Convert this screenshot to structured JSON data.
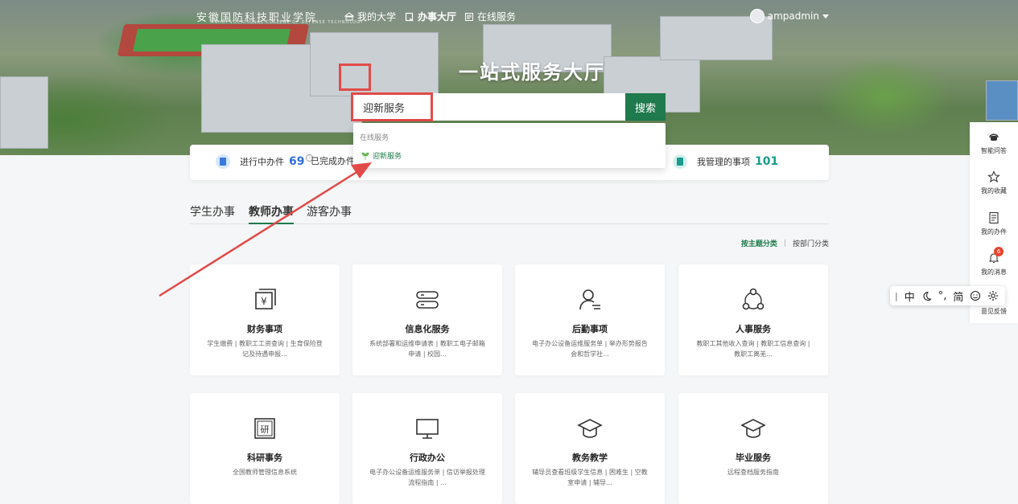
{
  "header": {
    "logo_text": "安徽国防科技职业学院",
    "logo_sub": "ANHUI VOCATIONAL COLLEGE OF DEFENSE TECHNOLOGY",
    "nav": [
      {
        "label": "我的大学",
        "icon": "university-icon"
      },
      {
        "label": "办事大厅",
        "icon": "service-hall-icon"
      },
      {
        "label": "在线服务",
        "icon": "online-service-icon"
      }
    ],
    "user": "ampadmin"
  },
  "hero": {
    "title": "一站式服务大厅"
  },
  "search": {
    "value": "迎新服务",
    "button": "搜索"
  },
  "dropdown": {
    "group": "在线服务",
    "item": "迎新服务"
  },
  "stats": {
    "in_progress_label": "进行中办件",
    "in_progress_value": "69",
    "completed_label": "已完成办件",
    "managed_label": "我管理的事项",
    "managed_value": "101"
  },
  "tabs": [
    "学生办事",
    "教师办事",
    "游客办事"
  ],
  "sort": {
    "by_theme": "按主题分类",
    "by_dept": "按部门分类"
  },
  "cards": [
    {
      "title": "财务事项",
      "desc": "学生缴费 | 教职工工资查询 | 生育保险登记及待遇申报...",
      "icon": "finance-icon"
    },
    {
      "title": "信息化服务",
      "desc": "系统部署和运维申请表 | 教职工电子邮箱申请 | 校园...",
      "icon": "server-icon"
    },
    {
      "title": "后勤事项",
      "desc": "电子办公设备运维服务单 | 举办形势报告会和哲学社...",
      "icon": "logistics-icon"
    },
    {
      "title": "人事服务",
      "desc": "教职工其他收入查询 | 教职工信息查询 | 教职工离羌...",
      "icon": "personnel-icon"
    },
    {
      "title": "科研事务",
      "desc": "全国教师管理信息系统",
      "icon": "research-icon"
    },
    {
      "title": "行政办公",
      "desc": "电子办公设备运维服务单 | 信访举报处理流程指南 | ...",
      "icon": "monitor-icon"
    },
    {
      "title": "教务教学",
      "desc": "辅导员查看班级学生信息 | 困难生 | 空教室申请 | 辅导...",
      "icon": "graduation-cap-icon"
    },
    {
      "title": "毕业服务",
      "desc": "远程查档服务指南",
      "icon": "graduation-cap-icon"
    }
  ],
  "sidebar": [
    {
      "label": "智能问答",
      "icon": "robot-icon"
    },
    {
      "label": "我的收藏",
      "icon": "star-icon"
    },
    {
      "label": "我的办件",
      "icon": "document-icon"
    },
    {
      "label": "我的消息",
      "icon": "bell-icon",
      "badge": "6"
    },
    {
      "label": "意见反馈",
      "icon": "feedback-icon"
    }
  ],
  "ime": {
    "items": [
      "中",
      "°,",
      "简"
    ]
  },
  "colors": {
    "accent": "#1f7a4d",
    "highlight": "#e24a4a",
    "stat_blue": "#2f6fdc",
    "stat_teal": "#1a9b8e"
  }
}
